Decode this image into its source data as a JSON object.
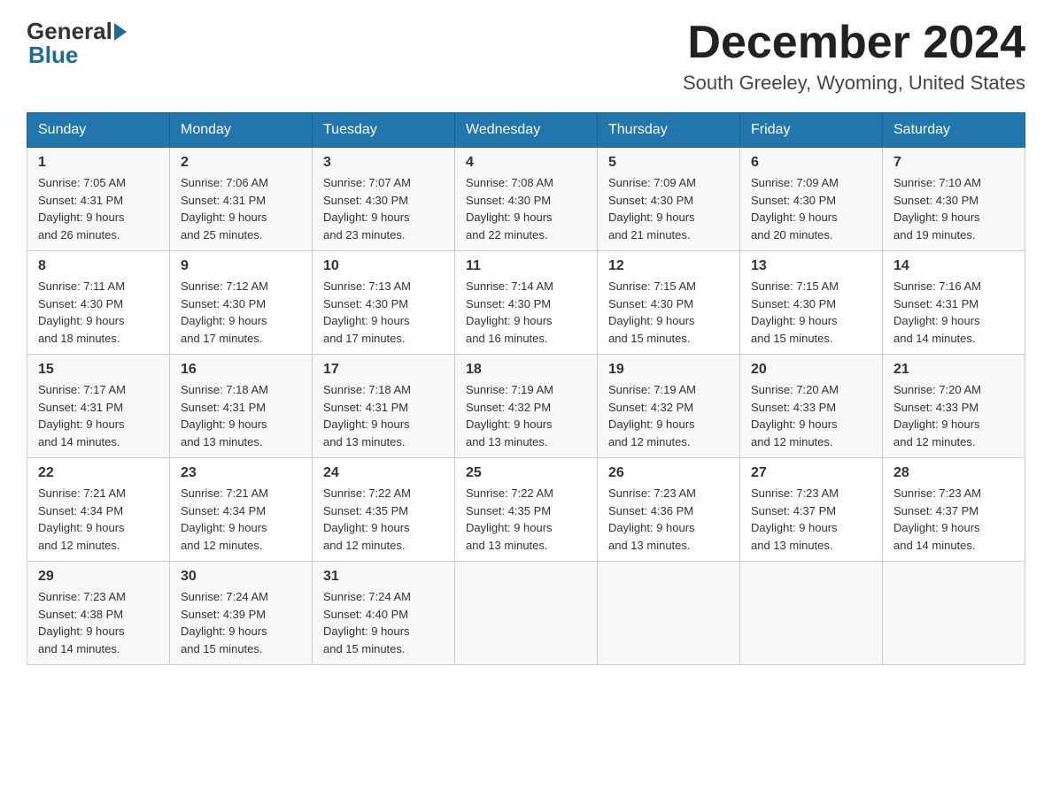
{
  "header": {
    "logo_text_general": "General",
    "logo_text_blue": "Blue",
    "month_title": "December 2024",
    "location": "South Greeley, Wyoming, United States"
  },
  "days_of_week": [
    "Sunday",
    "Monday",
    "Tuesday",
    "Wednesday",
    "Thursday",
    "Friday",
    "Saturday"
  ],
  "weeks": [
    [
      {
        "day": "1",
        "sunrise": "7:05 AM",
        "sunset": "4:31 PM",
        "daylight": "9 hours and 26 minutes."
      },
      {
        "day": "2",
        "sunrise": "7:06 AM",
        "sunset": "4:31 PM",
        "daylight": "9 hours and 25 minutes."
      },
      {
        "day": "3",
        "sunrise": "7:07 AM",
        "sunset": "4:30 PM",
        "daylight": "9 hours and 23 minutes."
      },
      {
        "day": "4",
        "sunrise": "7:08 AM",
        "sunset": "4:30 PM",
        "daylight": "9 hours and 22 minutes."
      },
      {
        "day": "5",
        "sunrise": "7:09 AM",
        "sunset": "4:30 PM",
        "daylight": "9 hours and 21 minutes."
      },
      {
        "day": "6",
        "sunrise": "7:09 AM",
        "sunset": "4:30 PM",
        "daylight": "9 hours and 20 minutes."
      },
      {
        "day": "7",
        "sunrise": "7:10 AM",
        "sunset": "4:30 PM",
        "daylight": "9 hours and 19 minutes."
      }
    ],
    [
      {
        "day": "8",
        "sunrise": "7:11 AM",
        "sunset": "4:30 PM",
        "daylight": "9 hours and 18 minutes."
      },
      {
        "day": "9",
        "sunrise": "7:12 AM",
        "sunset": "4:30 PM",
        "daylight": "9 hours and 17 minutes."
      },
      {
        "day": "10",
        "sunrise": "7:13 AM",
        "sunset": "4:30 PM",
        "daylight": "9 hours and 17 minutes."
      },
      {
        "day": "11",
        "sunrise": "7:14 AM",
        "sunset": "4:30 PM",
        "daylight": "9 hours and 16 minutes."
      },
      {
        "day": "12",
        "sunrise": "7:15 AM",
        "sunset": "4:30 PM",
        "daylight": "9 hours and 15 minutes."
      },
      {
        "day": "13",
        "sunrise": "7:15 AM",
        "sunset": "4:30 PM",
        "daylight": "9 hours and 15 minutes."
      },
      {
        "day": "14",
        "sunrise": "7:16 AM",
        "sunset": "4:31 PM",
        "daylight": "9 hours and 14 minutes."
      }
    ],
    [
      {
        "day": "15",
        "sunrise": "7:17 AM",
        "sunset": "4:31 PM",
        "daylight": "9 hours and 14 minutes."
      },
      {
        "day": "16",
        "sunrise": "7:18 AM",
        "sunset": "4:31 PM",
        "daylight": "9 hours and 13 minutes."
      },
      {
        "day": "17",
        "sunrise": "7:18 AM",
        "sunset": "4:31 PM",
        "daylight": "9 hours and 13 minutes."
      },
      {
        "day": "18",
        "sunrise": "7:19 AM",
        "sunset": "4:32 PM",
        "daylight": "9 hours and 13 minutes."
      },
      {
        "day": "19",
        "sunrise": "7:19 AM",
        "sunset": "4:32 PM",
        "daylight": "9 hours and 12 minutes."
      },
      {
        "day": "20",
        "sunrise": "7:20 AM",
        "sunset": "4:33 PM",
        "daylight": "9 hours and 12 minutes."
      },
      {
        "day": "21",
        "sunrise": "7:20 AM",
        "sunset": "4:33 PM",
        "daylight": "9 hours and 12 minutes."
      }
    ],
    [
      {
        "day": "22",
        "sunrise": "7:21 AM",
        "sunset": "4:34 PM",
        "daylight": "9 hours and 12 minutes."
      },
      {
        "day": "23",
        "sunrise": "7:21 AM",
        "sunset": "4:34 PM",
        "daylight": "9 hours and 12 minutes."
      },
      {
        "day": "24",
        "sunrise": "7:22 AM",
        "sunset": "4:35 PM",
        "daylight": "9 hours and 12 minutes."
      },
      {
        "day": "25",
        "sunrise": "7:22 AM",
        "sunset": "4:35 PM",
        "daylight": "9 hours and 13 minutes."
      },
      {
        "day": "26",
        "sunrise": "7:23 AM",
        "sunset": "4:36 PM",
        "daylight": "9 hours and 13 minutes."
      },
      {
        "day": "27",
        "sunrise": "7:23 AM",
        "sunset": "4:37 PM",
        "daylight": "9 hours and 13 minutes."
      },
      {
        "day": "28",
        "sunrise": "7:23 AM",
        "sunset": "4:37 PM",
        "daylight": "9 hours and 14 minutes."
      }
    ],
    [
      {
        "day": "29",
        "sunrise": "7:23 AM",
        "sunset": "4:38 PM",
        "daylight": "9 hours and 14 minutes."
      },
      {
        "day": "30",
        "sunrise": "7:24 AM",
        "sunset": "4:39 PM",
        "daylight": "9 hours and 15 minutes."
      },
      {
        "day": "31",
        "sunrise": "7:24 AM",
        "sunset": "4:40 PM",
        "daylight": "9 hours and 15 minutes."
      },
      null,
      null,
      null,
      null
    ]
  ]
}
